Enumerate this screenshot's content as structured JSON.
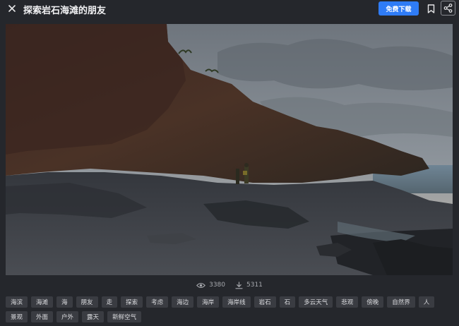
{
  "header": {
    "title": "探索岩石海滩的朋友",
    "download_label": "免费下载"
  },
  "stats": {
    "views": "3380",
    "downloads": "5311"
  },
  "tags": [
    "海滨",
    "海滩",
    "海",
    "朋友",
    "走",
    "探索",
    "考虑",
    "海边",
    "海岸",
    "海岸线",
    "岩石",
    "石",
    "多云天气",
    "悲观",
    "傍晚",
    "自然界",
    "人",
    "景观",
    "外面",
    "户外",
    "露天",
    "新鲜空气"
  ],
  "colors": {
    "accent": "#2f7cf6",
    "background": "#25272c",
    "tag_background": "#3a3c42"
  },
  "icons": {
    "close": "close-icon",
    "bookmark": "bookmark-icon",
    "share": "share-icon",
    "views": "eye-icon",
    "downloads": "download-icon"
  }
}
